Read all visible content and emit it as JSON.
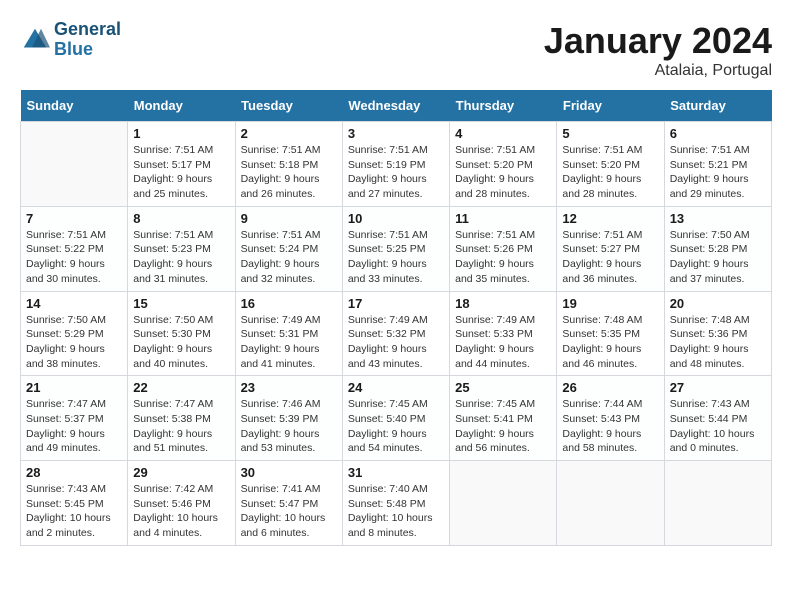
{
  "header": {
    "logo_line1": "General",
    "logo_line2": "Blue",
    "month_title": "January 2024",
    "location": "Atalaia, Portugal"
  },
  "days_of_week": [
    "Sunday",
    "Monday",
    "Tuesday",
    "Wednesday",
    "Thursday",
    "Friday",
    "Saturday"
  ],
  "weeks": [
    [
      {
        "day": "",
        "info": ""
      },
      {
        "day": "1",
        "info": "Sunrise: 7:51 AM\nSunset: 5:17 PM\nDaylight: 9 hours\nand 25 minutes."
      },
      {
        "day": "2",
        "info": "Sunrise: 7:51 AM\nSunset: 5:18 PM\nDaylight: 9 hours\nand 26 minutes."
      },
      {
        "day": "3",
        "info": "Sunrise: 7:51 AM\nSunset: 5:19 PM\nDaylight: 9 hours\nand 27 minutes."
      },
      {
        "day": "4",
        "info": "Sunrise: 7:51 AM\nSunset: 5:20 PM\nDaylight: 9 hours\nand 28 minutes."
      },
      {
        "day": "5",
        "info": "Sunrise: 7:51 AM\nSunset: 5:20 PM\nDaylight: 9 hours\nand 28 minutes."
      },
      {
        "day": "6",
        "info": "Sunrise: 7:51 AM\nSunset: 5:21 PM\nDaylight: 9 hours\nand 29 minutes."
      }
    ],
    [
      {
        "day": "7",
        "info": "Sunrise: 7:51 AM\nSunset: 5:22 PM\nDaylight: 9 hours\nand 30 minutes."
      },
      {
        "day": "8",
        "info": "Sunrise: 7:51 AM\nSunset: 5:23 PM\nDaylight: 9 hours\nand 31 minutes."
      },
      {
        "day": "9",
        "info": "Sunrise: 7:51 AM\nSunset: 5:24 PM\nDaylight: 9 hours\nand 32 minutes."
      },
      {
        "day": "10",
        "info": "Sunrise: 7:51 AM\nSunset: 5:25 PM\nDaylight: 9 hours\nand 33 minutes."
      },
      {
        "day": "11",
        "info": "Sunrise: 7:51 AM\nSunset: 5:26 PM\nDaylight: 9 hours\nand 35 minutes."
      },
      {
        "day": "12",
        "info": "Sunrise: 7:51 AM\nSunset: 5:27 PM\nDaylight: 9 hours\nand 36 minutes."
      },
      {
        "day": "13",
        "info": "Sunrise: 7:50 AM\nSunset: 5:28 PM\nDaylight: 9 hours\nand 37 minutes."
      }
    ],
    [
      {
        "day": "14",
        "info": "Sunrise: 7:50 AM\nSunset: 5:29 PM\nDaylight: 9 hours\nand 38 minutes."
      },
      {
        "day": "15",
        "info": "Sunrise: 7:50 AM\nSunset: 5:30 PM\nDaylight: 9 hours\nand 40 minutes."
      },
      {
        "day": "16",
        "info": "Sunrise: 7:49 AM\nSunset: 5:31 PM\nDaylight: 9 hours\nand 41 minutes."
      },
      {
        "day": "17",
        "info": "Sunrise: 7:49 AM\nSunset: 5:32 PM\nDaylight: 9 hours\nand 43 minutes."
      },
      {
        "day": "18",
        "info": "Sunrise: 7:49 AM\nSunset: 5:33 PM\nDaylight: 9 hours\nand 44 minutes."
      },
      {
        "day": "19",
        "info": "Sunrise: 7:48 AM\nSunset: 5:35 PM\nDaylight: 9 hours\nand 46 minutes."
      },
      {
        "day": "20",
        "info": "Sunrise: 7:48 AM\nSunset: 5:36 PM\nDaylight: 9 hours\nand 48 minutes."
      }
    ],
    [
      {
        "day": "21",
        "info": "Sunrise: 7:47 AM\nSunset: 5:37 PM\nDaylight: 9 hours\nand 49 minutes."
      },
      {
        "day": "22",
        "info": "Sunrise: 7:47 AM\nSunset: 5:38 PM\nDaylight: 9 hours\nand 51 minutes."
      },
      {
        "day": "23",
        "info": "Sunrise: 7:46 AM\nSunset: 5:39 PM\nDaylight: 9 hours\nand 53 minutes."
      },
      {
        "day": "24",
        "info": "Sunrise: 7:45 AM\nSunset: 5:40 PM\nDaylight: 9 hours\nand 54 minutes."
      },
      {
        "day": "25",
        "info": "Sunrise: 7:45 AM\nSunset: 5:41 PM\nDaylight: 9 hours\nand 56 minutes."
      },
      {
        "day": "26",
        "info": "Sunrise: 7:44 AM\nSunset: 5:43 PM\nDaylight: 9 hours\nand 58 minutes."
      },
      {
        "day": "27",
        "info": "Sunrise: 7:43 AM\nSunset: 5:44 PM\nDaylight: 10 hours\nand 0 minutes."
      }
    ],
    [
      {
        "day": "28",
        "info": "Sunrise: 7:43 AM\nSunset: 5:45 PM\nDaylight: 10 hours\nand 2 minutes."
      },
      {
        "day": "29",
        "info": "Sunrise: 7:42 AM\nSunset: 5:46 PM\nDaylight: 10 hours\nand 4 minutes."
      },
      {
        "day": "30",
        "info": "Sunrise: 7:41 AM\nSunset: 5:47 PM\nDaylight: 10 hours\nand 6 minutes."
      },
      {
        "day": "31",
        "info": "Sunrise: 7:40 AM\nSunset: 5:48 PM\nDaylight: 10 hours\nand 8 minutes."
      },
      {
        "day": "",
        "info": ""
      },
      {
        "day": "",
        "info": ""
      },
      {
        "day": "",
        "info": ""
      }
    ]
  ]
}
